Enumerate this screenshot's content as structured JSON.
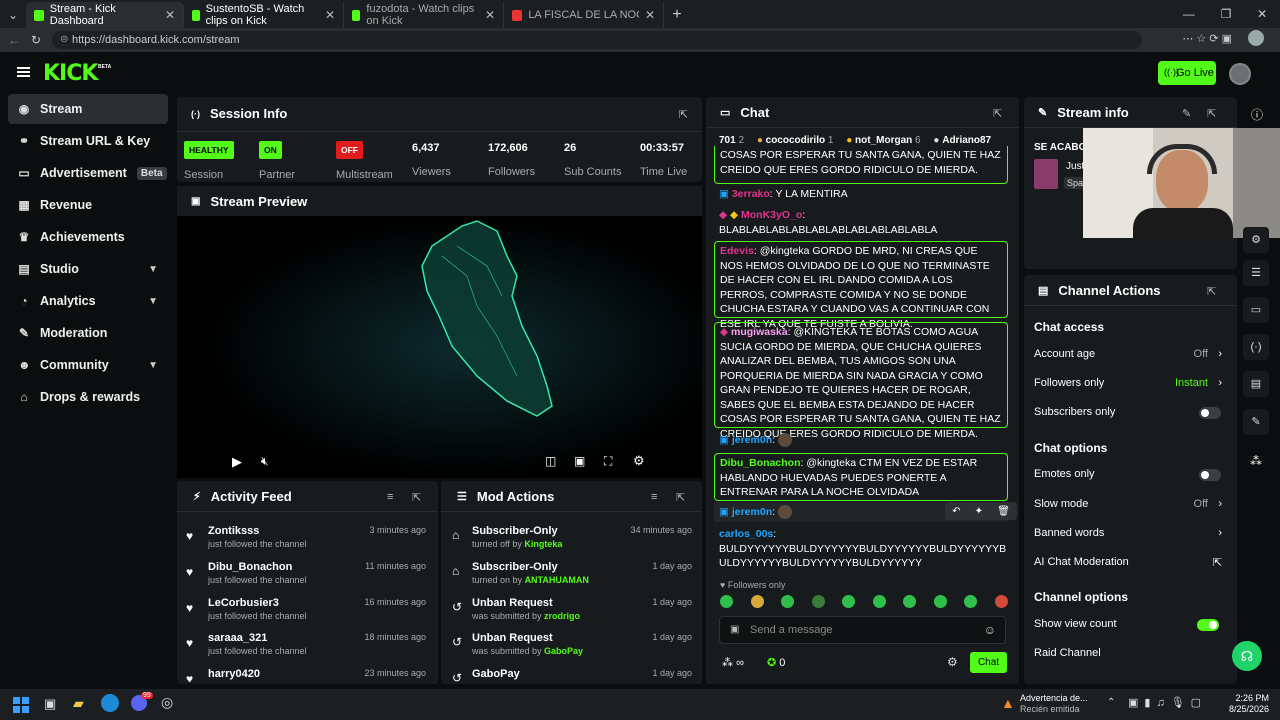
{
  "browser": {
    "tabs": [
      {
        "label": "Stream - Kick Dashboard",
        "active": true
      },
      {
        "label": "SustentoSB - Watch clips on Kick"
      },
      {
        "label": "fuzodota - Watch clips on Kick"
      },
      {
        "label": "LA FISCAL DE LA NOCHE - PIURA"
      }
    ],
    "url": "https://dashboard.kick.com/stream"
  },
  "header": {
    "logo": "KICK",
    "logo_badge": "BETA",
    "go_live": "Go Live"
  },
  "sidebar": {
    "items": [
      {
        "label": "Stream",
        "icon": "radio-icon"
      },
      {
        "label": "Stream URL & Key",
        "icon": "link-icon"
      },
      {
        "label": "Advertisement",
        "icon": "tv-icon",
        "badge": "Beta"
      },
      {
        "label": "Revenue",
        "icon": "revenue-icon"
      },
      {
        "label": "Achievements",
        "icon": "trophy-icon"
      },
      {
        "label": "Studio",
        "icon": "studio-icon"
      },
      {
        "label": "Analytics",
        "icon": "chart-icon"
      },
      {
        "label": "Moderation",
        "icon": "wrench-icon"
      },
      {
        "label": "Community",
        "icon": "people-icon"
      },
      {
        "label": "Drops & rewards",
        "icon": "gift-icon"
      }
    ]
  },
  "session": {
    "title": "Session Info",
    "stats": [
      {
        "badge": "HEALTHY",
        "label": "Session",
        "color": "#53fc18"
      },
      {
        "badge": "ON",
        "label": "Partner",
        "color": "#53fc18"
      },
      {
        "badge": "OFF",
        "label": "Multistream",
        "color": "#e01c1c"
      },
      {
        "value": "6,437",
        "label": "Viewers"
      },
      {
        "value": "172,606",
        "label": "Followers"
      },
      {
        "value": "26",
        "label": "Sub Counts"
      },
      {
        "value": "00:33:57",
        "label": "Time Live"
      }
    ]
  },
  "preview": {
    "title": "Stream Preview"
  },
  "activity": {
    "title": "Activity Feed",
    "items": [
      {
        "name": "Zontiksss",
        "sub": "just followed the channel",
        "time": "3 minutes ago"
      },
      {
        "name": "Dibu_Bonachon",
        "sub": "just followed the channel",
        "time": "11 minutes ago"
      },
      {
        "name": "LeCorbusier3",
        "sub": "just followed the channel",
        "time": "16 minutes ago"
      },
      {
        "name": "saraaa_321",
        "sub": "just followed the channel",
        "time": "18 minutes ago"
      },
      {
        "name": "harry0420",
        "sub": "",
        "time": "23 minutes ago"
      }
    ]
  },
  "modactions": {
    "title": "Mod Actions",
    "items": [
      {
        "name": "Subscriber-Only",
        "pre": "turned off by",
        "by": "Kingteka",
        "time": "34 minutes ago"
      },
      {
        "name": "Subscriber-Only",
        "pre": "turned on by",
        "by": "ANTAHUAMAN",
        "time": "1 day ago"
      },
      {
        "name": "Unban Request",
        "pre": "was submitted by",
        "by": "zrodrigo",
        "time": "1 day ago"
      },
      {
        "name": "Unban Request",
        "pre": "was submitted by",
        "by": "GaboPay",
        "time": "1 day ago"
      },
      {
        "name": "GaboPay",
        "pre": "",
        "by": "",
        "time": "1 day ago"
      }
    ]
  },
  "chat": {
    "title": "Chat",
    "top_users": [
      {
        "name": "701",
        "rank": "2"
      },
      {
        "name": "cococodirilo",
        "rank": "1"
      },
      {
        "name": "not_Morgan",
        "rank": "6"
      },
      {
        "name": "Adriano87"
      }
    ],
    "messages": [
      {
        "user": "",
        "text": "COSAS POR ESPERAR TU SANTA GANA, QUIEN TE HAZ CREIDO QUE ERES GORDO RIDICULO DE MIERDA."
      },
      {
        "user": "3errako",
        "user_color": "#e0348f",
        "text": "Y LA MENTIRA"
      },
      {
        "user": "MonK3yO_o",
        "user_color": "#e0348f",
        "text": "BLABLABLABLABLABLABLABLABLABLABLA"
      },
      {
        "user": "Edevis",
        "user_color": "#e0348f",
        "text": "@kingteka GORDO DE MRD, NI CREAS QUE NOS HEMOS OLVIDADO DE LO QUE NO TERMINASTE DE HACER CON EL IRL DANDO COMIDA A LOS PERROS, COMPRASTE COMIDA Y NO SE DONDE CHUCHA ESTARA Y CUANDO VAS A CONTINUAR CON ESE IRL YA QUE TE FUISTE A BOLIVIA."
      },
      {
        "user": "mugiwaska",
        "user_color": "#fe9df6",
        "text": "@KINGTEKA TE BOTAS COMO AGUA SUCIA GORDO DE MIERDA, QUE CHUCHA QUIERES ANALIZAR DEL BEMBA, TUS AMIGOS SON UNA PORQUERIA DE MIERDA SIN NADA GRACIA Y COMO GRAN PENDEJO TE QUIERES HACER DE ROGAR, SABES QUE EL BEMBA ESTA DEJANDO DE HACER COSAS POR ESPERAR TU SANTA GANA, QUIEN TE HAZ CREIDO QUE ERES GORDO RIDICULO DE MIERDA."
      },
      {
        "user": "jerem0n",
        "user_color": "#1ea5ff",
        "text": ""
      },
      {
        "user": "Dibu_Bonachon",
        "user_color": "#53fc18",
        "text": "@kingteka CTM EN VEZ DE ESTAR HABLANDO HUEVADAS PUEDES PONERTE A ENTRENAR PARA LA NOCHE OLVIDADA"
      },
      {
        "user": "jerem0n",
        "user_color": "#1ea5ff",
        "text": ""
      },
      {
        "user": "carlos_00s",
        "user_color": "#1ea5ff",
        "text": "BULDYYYYYYBULDYYYYYYBULDYYYYYYBULDYYYYYYBULDYYYYYYBULDYYYYYYBULDYYYYYY"
      }
    ],
    "followers_only": "Followers only",
    "placeholder": "Send a message",
    "send": "Chat",
    "infinity": "∞",
    "count": "0"
  },
  "stream_info": {
    "title": "Stream info",
    "line1": "SE ACABO",
    "line2": "Just",
    "line3": "Spa"
  },
  "channel_actions": {
    "title": "Channel Actions",
    "chat_access": "Chat access",
    "account_age": {
      "label": "Account age",
      "value": "Off"
    },
    "followers_only": {
      "label": "Followers only",
      "value": "Instant"
    },
    "subscribers_only": {
      "label": "Subscribers only",
      "on": false
    },
    "chat_options": "Chat options",
    "emotes_only": {
      "label": "Emotes only",
      "on": false
    },
    "slow_mode": {
      "label": "Slow mode",
      "value": "Off"
    },
    "banned_words": {
      "label": "Banned words"
    },
    "ai_mod": {
      "label": "AI Chat Moderation"
    },
    "channel_options": "Channel options",
    "show_view_count": {
      "label": "Show view count",
      "on": true
    },
    "raid": {
      "label": "Raid Channel"
    }
  },
  "taskbar": {
    "notif_title": "Advertencia de...",
    "notif_sub": "Recién emitida",
    "time": "2:26 PM",
    "date": "8/25/2026",
    "badge": "99"
  }
}
